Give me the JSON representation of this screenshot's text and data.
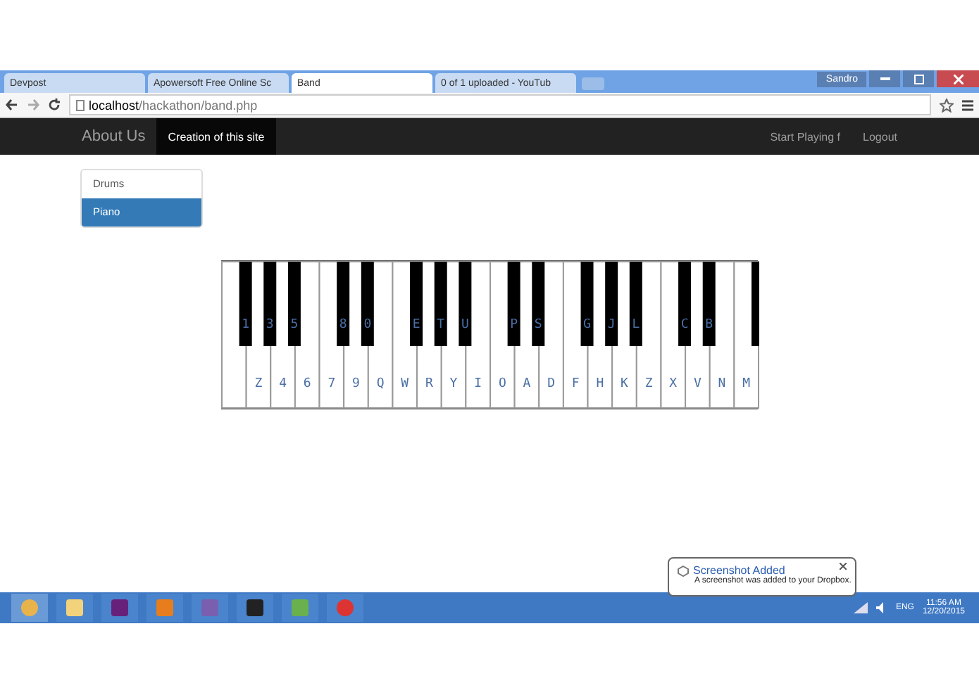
{
  "browser": {
    "tabs": [
      {
        "title": "Devpost",
        "selected": false
      },
      {
        "title": "Apowersoft Free Online Sc",
        "selected": false
      },
      {
        "title": "Band",
        "selected": true
      },
      {
        "title": "0 of 1 uploaded - YouTub",
        "selected": false
      }
    ],
    "user": "Sandro",
    "address_host": "localhost",
    "address_path": "/hackathon/band.php"
  },
  "navbar": {
    "brand": "About Us",
    "links": [
      {
        "label": "Creation of this site",
        "selected": true
      }
    ],
    "right_links": [
      "Start Playing f",
      "Logout"
    ]
  },
  "sidebar": {
    "items": [
      {
        "label": "Drums",
        "selected": false
      },
      {
        "label": "Piano",
        "selected": true
      }
    ]
  },
  "piano": {
    "keys": [
      {
        "has_sharp": true,
        "sharp": "1"
      },
      {
        "label": "Z",
        "has_sharp": true,
        "sharp": "3"
      },
      {
        "label": "4",
        "has_sharp": true,
        "sharp": "5"
      },
      {
        "label": "6",
        "has_sharp": false
      },
      {
        "label": "7",
        "has_sharp": true,
        "sharp": "8"
      },
      {
        "label": "9",
        "has_sharp": true,
        "sharp": "0"
      },
      {
        "label": "Q",
        "has_sharp": false
      },
      {
        "label": "W",
        "has_sharp": true,
        "sharp": "E"
      },
      {
        "label": "R",
        "has_sharp": true,
        "sharp": "T"
      },
      {
        "label": "Y",
        "has_sharp": true,
        "sharp": "U"
      },
      {
        "label": "I",
        "has_sharp": false
      },
      {
        "label": "O",
        "has_sharp": true,
        "sharp": "P"
      },
      {
        "label": "A",
        "has_sharp": true,
        "sharp": "S"
      },
      {
        "label": "D",
        "has_sharp": false
      },
      {
        "label": "F",
        "has_sharp": true,
        "sharp": "G"
      },
      {
        "label": "H",
        "has_sharp": true,
        "sharp": "J"
      },
      {
        "label": "K",
        "has_sharp": true,
        "sharp": "L"
      },
      {
        "label": "Z",
        "has_sharp": false
      },
      {
        "label": "X",
        "has_sharp": true,
        "sharp": "C"
      },
      {
        "label": "V",
        "has_sharp": true,
        "sharp": "B"
      },
      {
        "label": "N",
        "has_sharp": false
      },
      {
        "label": "M",
        "has_sharp": true
      }
    ]
  },
  "notification": {
    "title": "Screenshot Added",
    "message": "A screenshot was added to your Dropbox."
  },
  "taskbar": {
    "language": "ENG",
    "time": "11:56 AM",
    "date": "12/20/2015"
  }
}
